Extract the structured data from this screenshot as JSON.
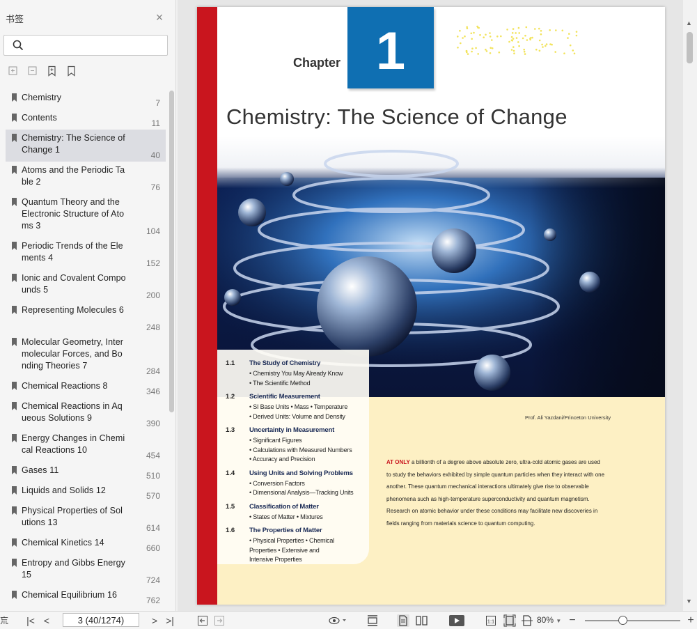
{
  "sidebar": {
    "title": "书签",
    "close_icon": "close-icon",
    "search": {
      "value": "",
      "placeholder": ""
    },
    "tools": [
      "expand-all-icon",
      "collapse-all-icon",
      "add-bookmark-icon",
      "bookmark-icon"
    ],
    "items": [
      {
        "label": "Chemistry",
        "page": "7"
      },
      {
        "label": "Contents",
        "page": "11"
      },
      {
        "label": "Chemistry: The Science of Change 1",
        "page": "40",
        "selected": true
      },
      {
        "label": "Atoms and the Periodic Table 2",
        "page": "76"
      },
      {
        "label": "Quantum Theory and the Electronic Structure of Atoms 3",
        "page": "104"
      },
      {
        "label": "Periodic Trends of the Elements 4",
        "page": "152"
      },
      {
        "label": "Ionic and Covalent Compounds 5",
        "page": "200"
      },
      {
        "label": "Representing Molecules 6",
        "page": "248"
      },
      {
        "label": "Molecular Geometry, Intermolecular Forces, and Bonding Theories 7",
        "page": "284"
      },
      {
        "label": "Chemical Reactions 8",
        "page": "346"
      },
      {
        "label": "Chemical Reactions in Aqueous Solutions 9",
        "page": "390"
      },
      {
        "label": "Energy Changes in Chemical Reactions 10",
        "page": "454"
      },
      {
        "label": "Gases 11",
        "page": "510"
      },
      {
        "label": "Liquids and Solids 12",
        "page": "570"
      },
      {
        "label": "Physical Properties of Solutions 13",
        "page": "614"
      },
      {
        "label": "Chemical Kinetics 14",
        "page": "660"
      },
      {
        "label": "Entropy and Gibbs Energy 15",
        "page": "724"
      },
      {
        "label": "Chemical Equilibrium 16",
        "page": "762"
      }
    ]
  },
  "page": {
    "chapter_word": "Chapter",
    "chapter_number": "1",
    "title": "Chemistry: The Science of Change",
    "photo_credit": "Prof. Ali Yazdani/Princeton University",
    "toc": [
      {
        "num": "1.1",
        "head": "The Study of Chemistry",
        "subs": [
          "• Chemistry You May Already Know",
          "• The Scientific Method"
        ]
      },
      {
        "num": "1.2",
        "head": "Scientific Measurement",
        "subs": [
          "• SI Base Units • Mass • Temperature",
          "• Derived Units: Volume and Density"
        ]
      },
      {
        "num": "1.3",
        "head": "Uncertainty in Measurement",
        "subs": [
          "• Significant Figures",
          "• Calculations with Measured Numbers",
          "• Accuracy and Precision"
        ]
      },
      {
        "num": "1.4",
        "head": "Using Units and Solving Problems",
        "subs": [
          "• Conversion Factors",
          "• Dimensional Analysis—Tracking Units"
        ]
      },
      {
        "num": "1.5",
        "head": "Classification of Matter",
        "subs": [
          "• States of Matter • Mixtures"
        ]
      },
      {
        "num": "1.6",
        "head": "The Properties of Matter",
        "subs": [
          "• Physical Properties • Chemical",
          "Properties • Extensive and",
          "Intensive Properties"
        ]
      }
    ],
    "intro_lead": "AT ONLY",
    "intro_text": " a billionth of a degree above absolute zero, ultra-cold atomic gases are used to study the behaviors exhibited by simple quantum particles when they interact with one another. These quantum mechanical interactions ultimately give rise to observable phenomena such as high-temperature superconductivity and quantum magnetism. Research on atomic behavior under these conditions may facilitate new discoveries in fields ranging from materials science to quantum computing."
  },
  "statusbar": {
    "left_fragment": "巟",
    "page_field": "3 (40/1274)",
    "zoom": "80%"
  },
  "colors": {
    "accent_red": "#c9151e",
    "chapter_blue": "#0f6fb2",
    "page_yellow": "#fdf0c4"
  }
}
